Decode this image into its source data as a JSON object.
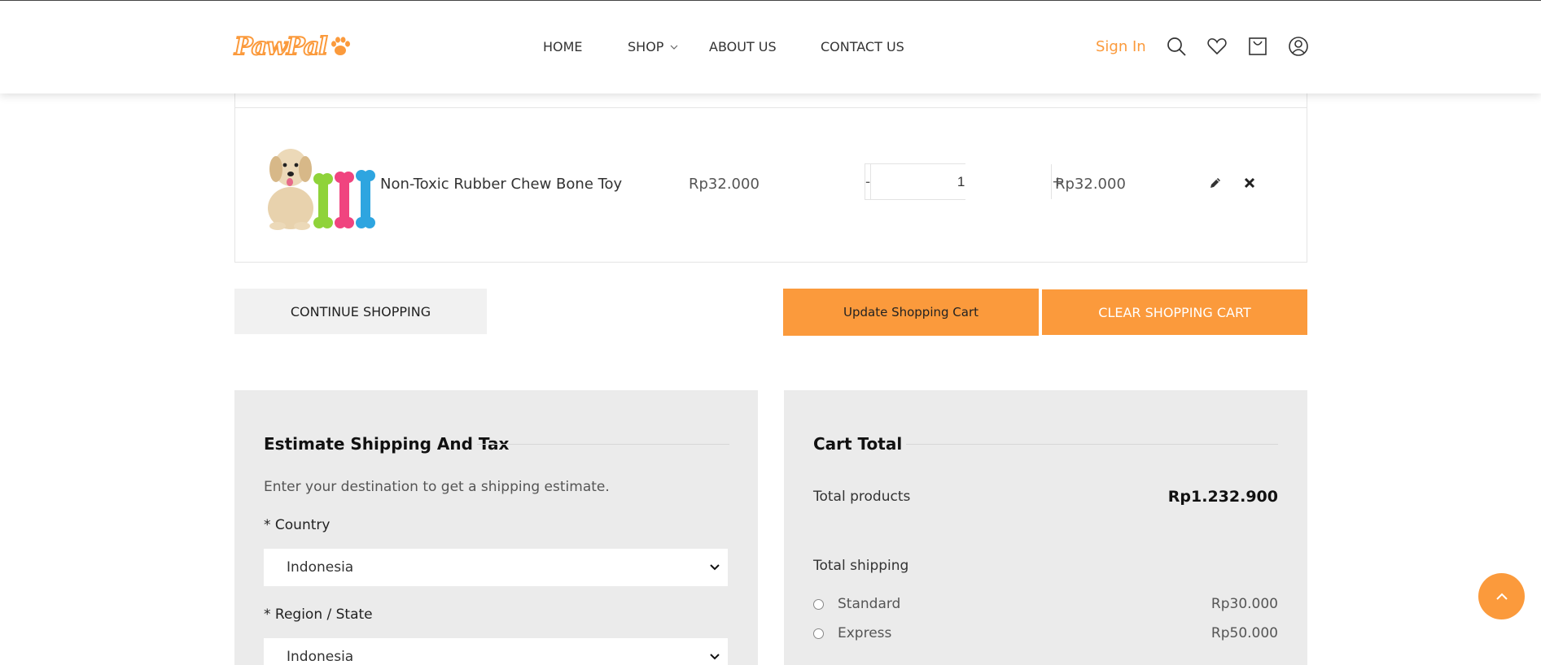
{
  "brand": {
    "logo_text": "PawPal",
    "accent_color": "#fb9a3c"
  },
  "nav": {
    "items": [
      {
        "label": "HOME"
      },
      {
        "label": "SHOP"
      },
      {
        "label": "ABOUT US"
      },
      {
        "label": "CONTACT US"
      }
    ]
  },
  "header": {
    "sign_in": "Sign In",
    "icons": [
      "search-icon",
      "heart-icon",
      "cart-icon",
      "user-icon"
    ]
  },
  "cart": {
    "items": [
      {
        "name": "Non-Toxic Rubber Chew Bone Toy",
        "unit_price": "Rp32.000",
        "quantity": "1",
        "subtotal": "Rp32.000",
        "image": "puppy-with-chew-bones"
      }
    ],
    "qty_minus": "-",
    "qty_plus": "+"
  },
  "buttons": {
    "continue": "CONTINUE SHOPPING",
    "update": "Update Shopping Cart",
    "clear": "CLEAR SHOPPING CART"
  },
  "shipping": {
    "title": "Estimate Shipping And Tax",
    "description": "Enter your destination to get a shipping estimate.",
    "country_label": "* Country",
    "country_value": "Indonesia",
    "region_label": "* Region / State",
    "region_value": "Indonesia"
  },
  "totals": {
    "title": "Cart Total",
    "products_label": "Total products",
    "products_value": "Rp1.232.900",
    "shipping_label": "Total shipping",
    "options": [
      {
        "label": "Standard",
        "price": "Rp30.000"
      },
      {
        "label": "Express",
        "price": "Rp50.000"
      }
    ]
  }
}
